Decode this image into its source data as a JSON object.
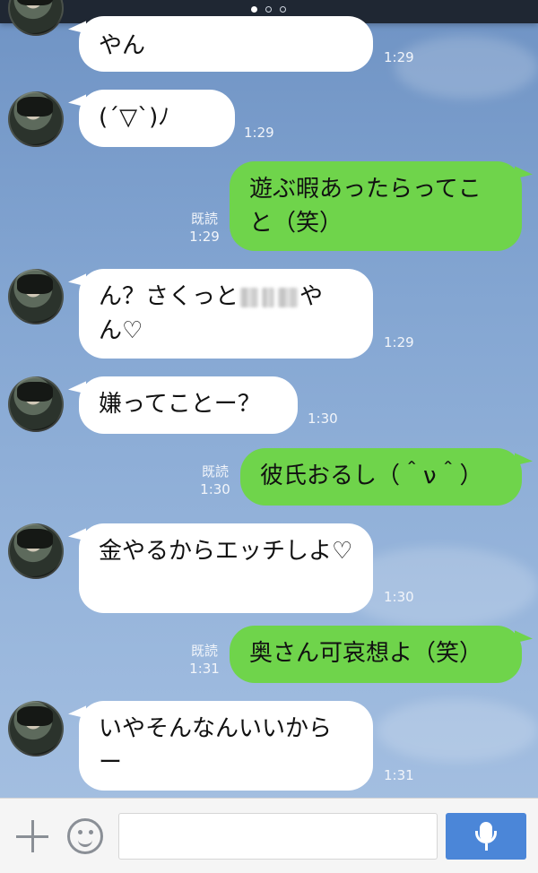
{
  "header": {
    "page_dots": 3,
    "active_dot": 0
  },
  "messages": [
    {
      "side": "in",
      "text": "やん",
      "time": "1:29"
    },
    {
      "side": "in",
      "text": "(´▽`)ﾉ",
      "time": "1:29"
    },
    {
      "side": "out",
      "text": "遊ぶ暇あったらってこと（笑）",
      "time": "1:29",
      "read": "既読"
    },
    {
      "side": "in",
      "text_a": "ん？さくっと",
      "text_b": "や",
      "text_c": "ん♡",
      "time": "1:29"
    },
    {
      "side": "in",
      "text": "嫌ってことー？",
      "time": "1:30"
    },
    {
      "side": "out",
      "text": "彼氏おるし（＾ν＾）",
      "time": "1:30",
      "read": "既読"
    },
    {
      "side": "in",
      "text": "金やるからエッチしよ♡",
      "time": "1:30"
    },
    {
      "side": "out",
      "text": "奥さん可哀想よ（笑）",
      "time": "1:31",
      "read": "既読"
    },
    {
      "side": "in",
      "text": "いやそんなんいいからー",
      "time": "1:31"
    }
  ],
  "input": {
    "placeholder": ""
  },
  "colors": {
    "outgoing": "#6fd44b",
    "incoming": "#ffffff",
    "send_button": "#4b86d8"
  },
  "icons": {
    "attach": "plus-icon",
    "emoji": "smiley-icon",
    "voice": "microphone-icon"
  }
}
